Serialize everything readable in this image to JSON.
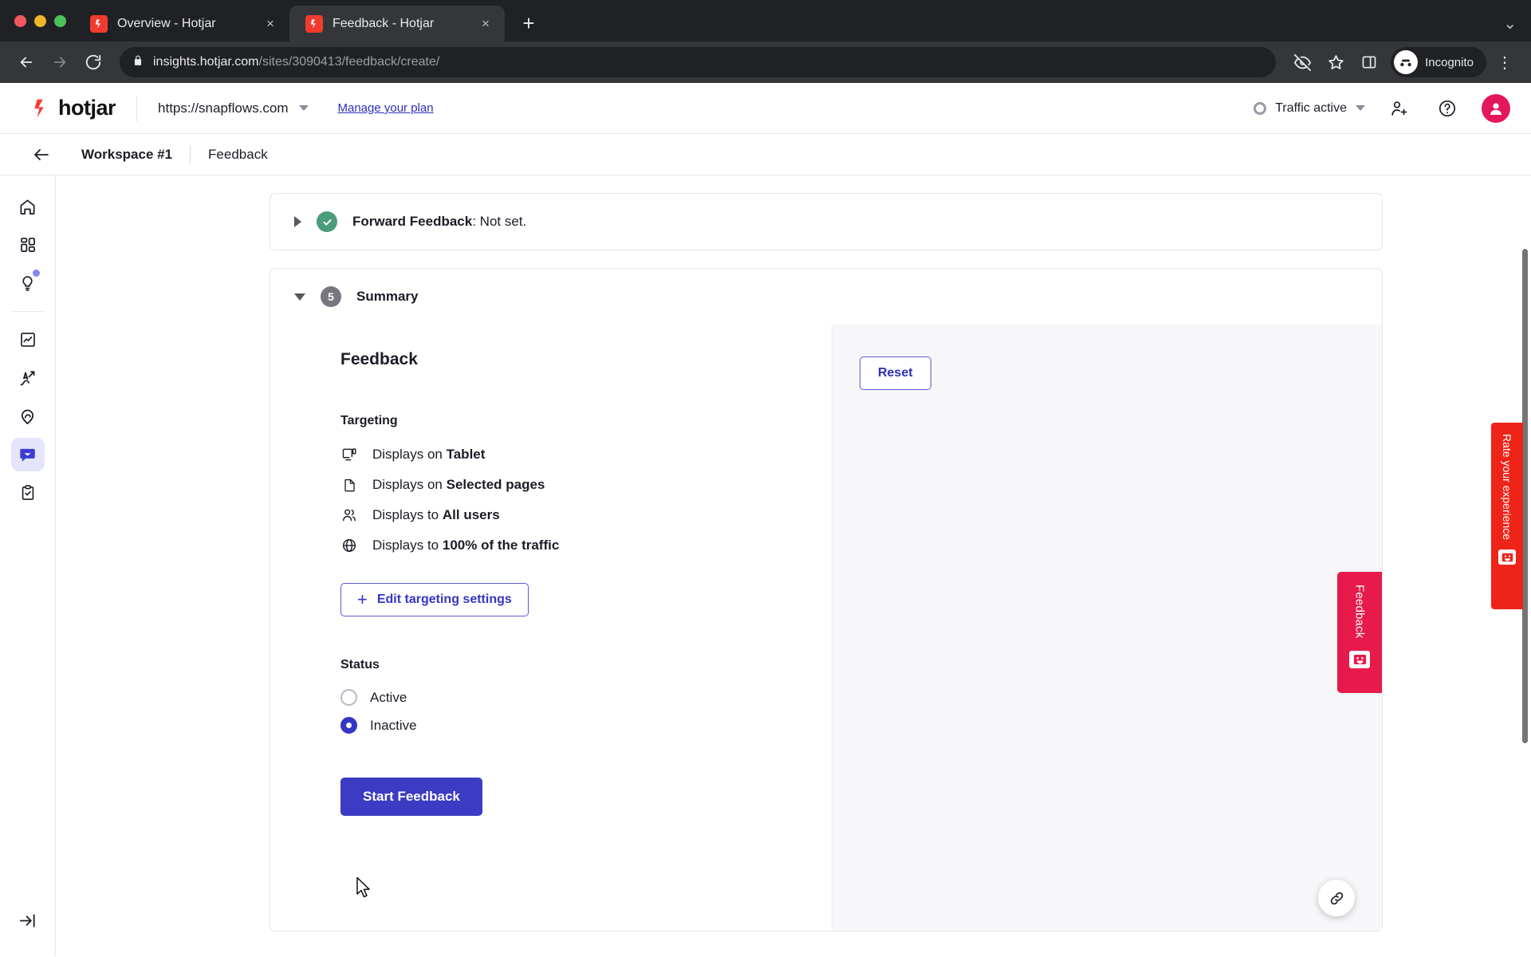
{
  "browser": {
    "tabs": [
      {
        "title": "Overview - Hotjar",
        "favicon": "hotjar-favicon",
        "active": false
      },
      {
        "title": "Feedback - Hotjar",
        "favicon": "hotjar-favicon",
        "active": true
      }
    ],
    "new_tab_label": "+",
    "close_label": "×",
    "window_menu_label": "⌄",
    "nav": {
      "back": "←",
      "forward": "→",
      "reload": "↻"
    },
    "address": {
      "secure_icon": "lock-icon",
      "host": "insights.hotjar.com",
      "path": "/sites/3090413/feedback/create/"
    },
    "toolbar_icons": [
      "eye-off-icon",
      "star-icon",
      "side-panel-icon"
    ],
    "profile": {
      "label": "Incognito",
      "icon": "incognito-icon"
    },
    "overflow_menu": "⋮"
  },
  "app_header": {
    "logo_text": "hotjar",
    "site": "https://snapflows.com",
    "site_caret": "chevron-down-icon",
    "manage_plan": "Manage your plan",
    "traffic_status": "Traffic active",
    "traffic_caret": "chevron-down-icon",
    "icons": [
      "invite-user-icon",
      "help-icon"
    ],
    "avatar": "user-avatar"
  },
  "breadcrumb": {
    "back": "back-arrow-icon",
    "workspace": "Workspace #1",
    "current": "Feedback"
  },
  "sidebar": {
    "items": [
      {
        "name": "home",
        "icon": "home-icon",
        "active": false,
        "badge": false
      },
      {
        "name": "dashboards",
        "icon": "grid-icon",
        "active": false,
        "badge": false
      },
      {
        "name": "insights",
        "icon": "lightbulb-icon",
        "active": false,
        "badge": true
      },
      {
        "name": "trends",
        "icon": "chart-icon",
        "active": false,
        "badge": false
      },
      {
        "name": "recordings",
        "icon": "cursor-path-icon",
        "active": false,
        "badge": false
      },
      {
        "name": "highlights",
        "icon": "pin-icon",
        "active": false,
        "badge": false
      },
      {
        "name": "feedback",
        "icon": "speech-bubble-icon",
        "active": true,
        "badge": false
      },
      {
        "name": "surveys",
        "icon": "clipboard-check-icon",
        "active": false,
        "badge": false
      }
    ],
    "collapse": {
      "name": "expand-sidebar",
      "icon": "arrow-to-line-icon"
    }
  },
  "cards": {
    "forward_feedback": {
      "toggle_icon": "triangle-right-icon",
      "badge_icon": "check-circle-icon",
      "title": "Forward Feedback",
      "detail": ": Not set."
    },
    "summary": {
      "toggle_icon": "triangle-down-icon",
      "step_number": "5",
      "title": "Summary"
    }
  },
  "summary": {
    "heading": "Feedback",
    "targeting_label": "Targeting",
    "targeting_rows": [
      {
        "icon": "device-icon",
        "prefix": "Displays on ",
        "value": "Tablet"
      },
      {
        "icon": "page-icon",
        "prefix": "Displays on ",
        "value": "Selected pages"
      },
      {
        "icon": "users-icon",
        "prefix": "Displays to ",
        "value": "All users"
      },
      {
        "icon": "globe-icon",
        "prefix": "Displays to ",
        "value": "100% of the traffic"
      }
    ],
    "edit_button": {
      "plus": "+",
      "label": "Edit targeting settings"
    },
    "status_label": "Status",
    "status_options": [
      {
        "label": "Active",
        "selected": false
      },
      {
        "label": "Inactive",
        "selected": true
      }
    ],
    "submit_button": "Start Feedback"
  },
  "preview": {
    "reset_button": "Reset",
    "widget": {
      "label": "Feedback",
      "face_icon": "smiley-icon",
      "color": "#e8194b"
    },
    "link_fab": "link-icon"
  },
  "edge_widget": {
    "label": "Rate your experience",
    "face_icon": "smiley-icon",
    "color": "#ef2418"
  }
}
